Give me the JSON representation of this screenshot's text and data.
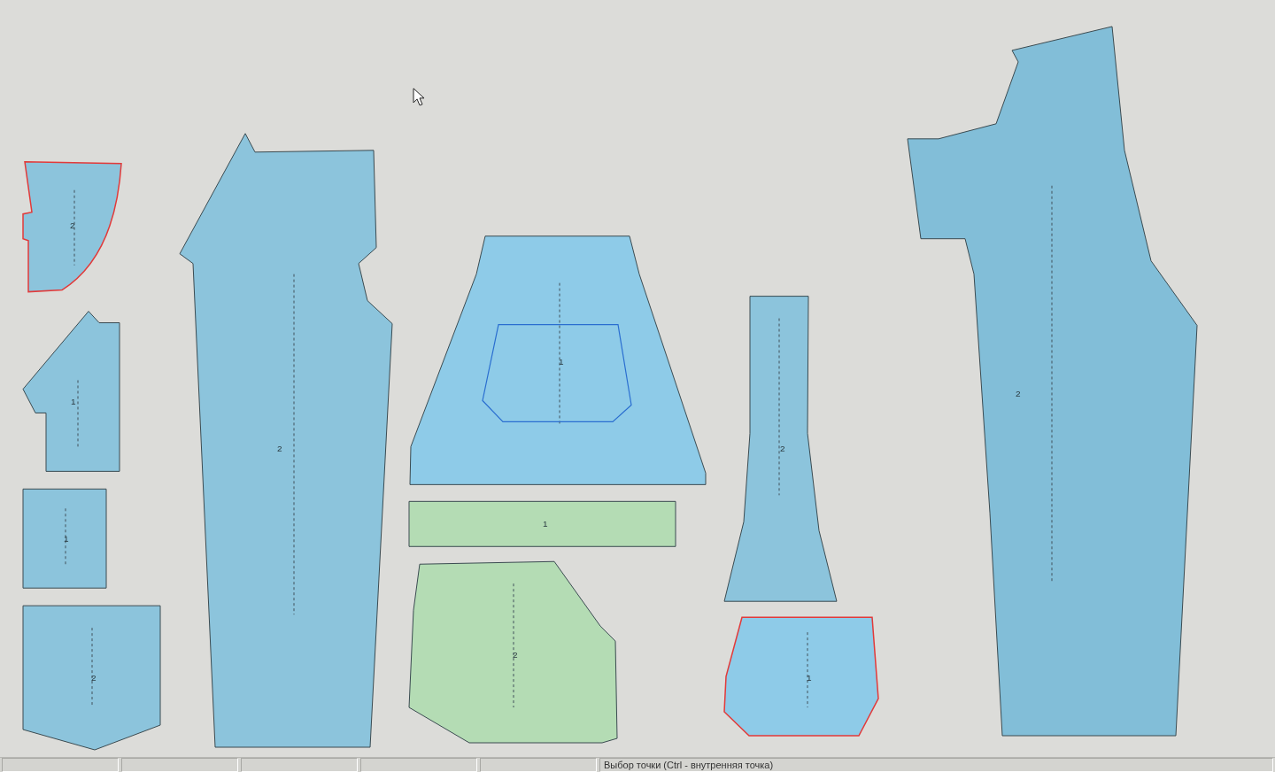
{
  "pieces": [
    {
      "label": "2",
      "color": "#8cc4dc",
      "selected": true
    },
    {
      "label": "1",
      "color": "#8cc4dc",
      "selected": false
    },
    {
      "label": "1",
      "color": "#8cc4dc",
      "selected": false
    },
    {
      "label": "2",
      "color": "#8cc4dc",
      "selected": false
    },
    {
      "label": "2",
      "color": "#8cc4dc",
      "selected": false
    },
    {
      "label": "1",
      "color": "#8ecbe8",
      "selected": false
    },
    {
      "label": "1",
      "color": "#b4dcb4",
      "selected": false
    },
    {
      "label": "2",
      "color": "#b4dcb4",
      "selected": false
    },
    {
      "label": "2",
      "color": "#8cc4dc",
      "selected": false
    },
    {
      "label": "1",
      "color": "#8ecbe8",
      "selected": true
    },
    {
      "label": "2",
      "color": "#82bed8",
      "selected": false
    }
  ],
  "status_bar": {
    "message": "Выбор точки (Ctrl - внутренняя точка)"
  }
}
